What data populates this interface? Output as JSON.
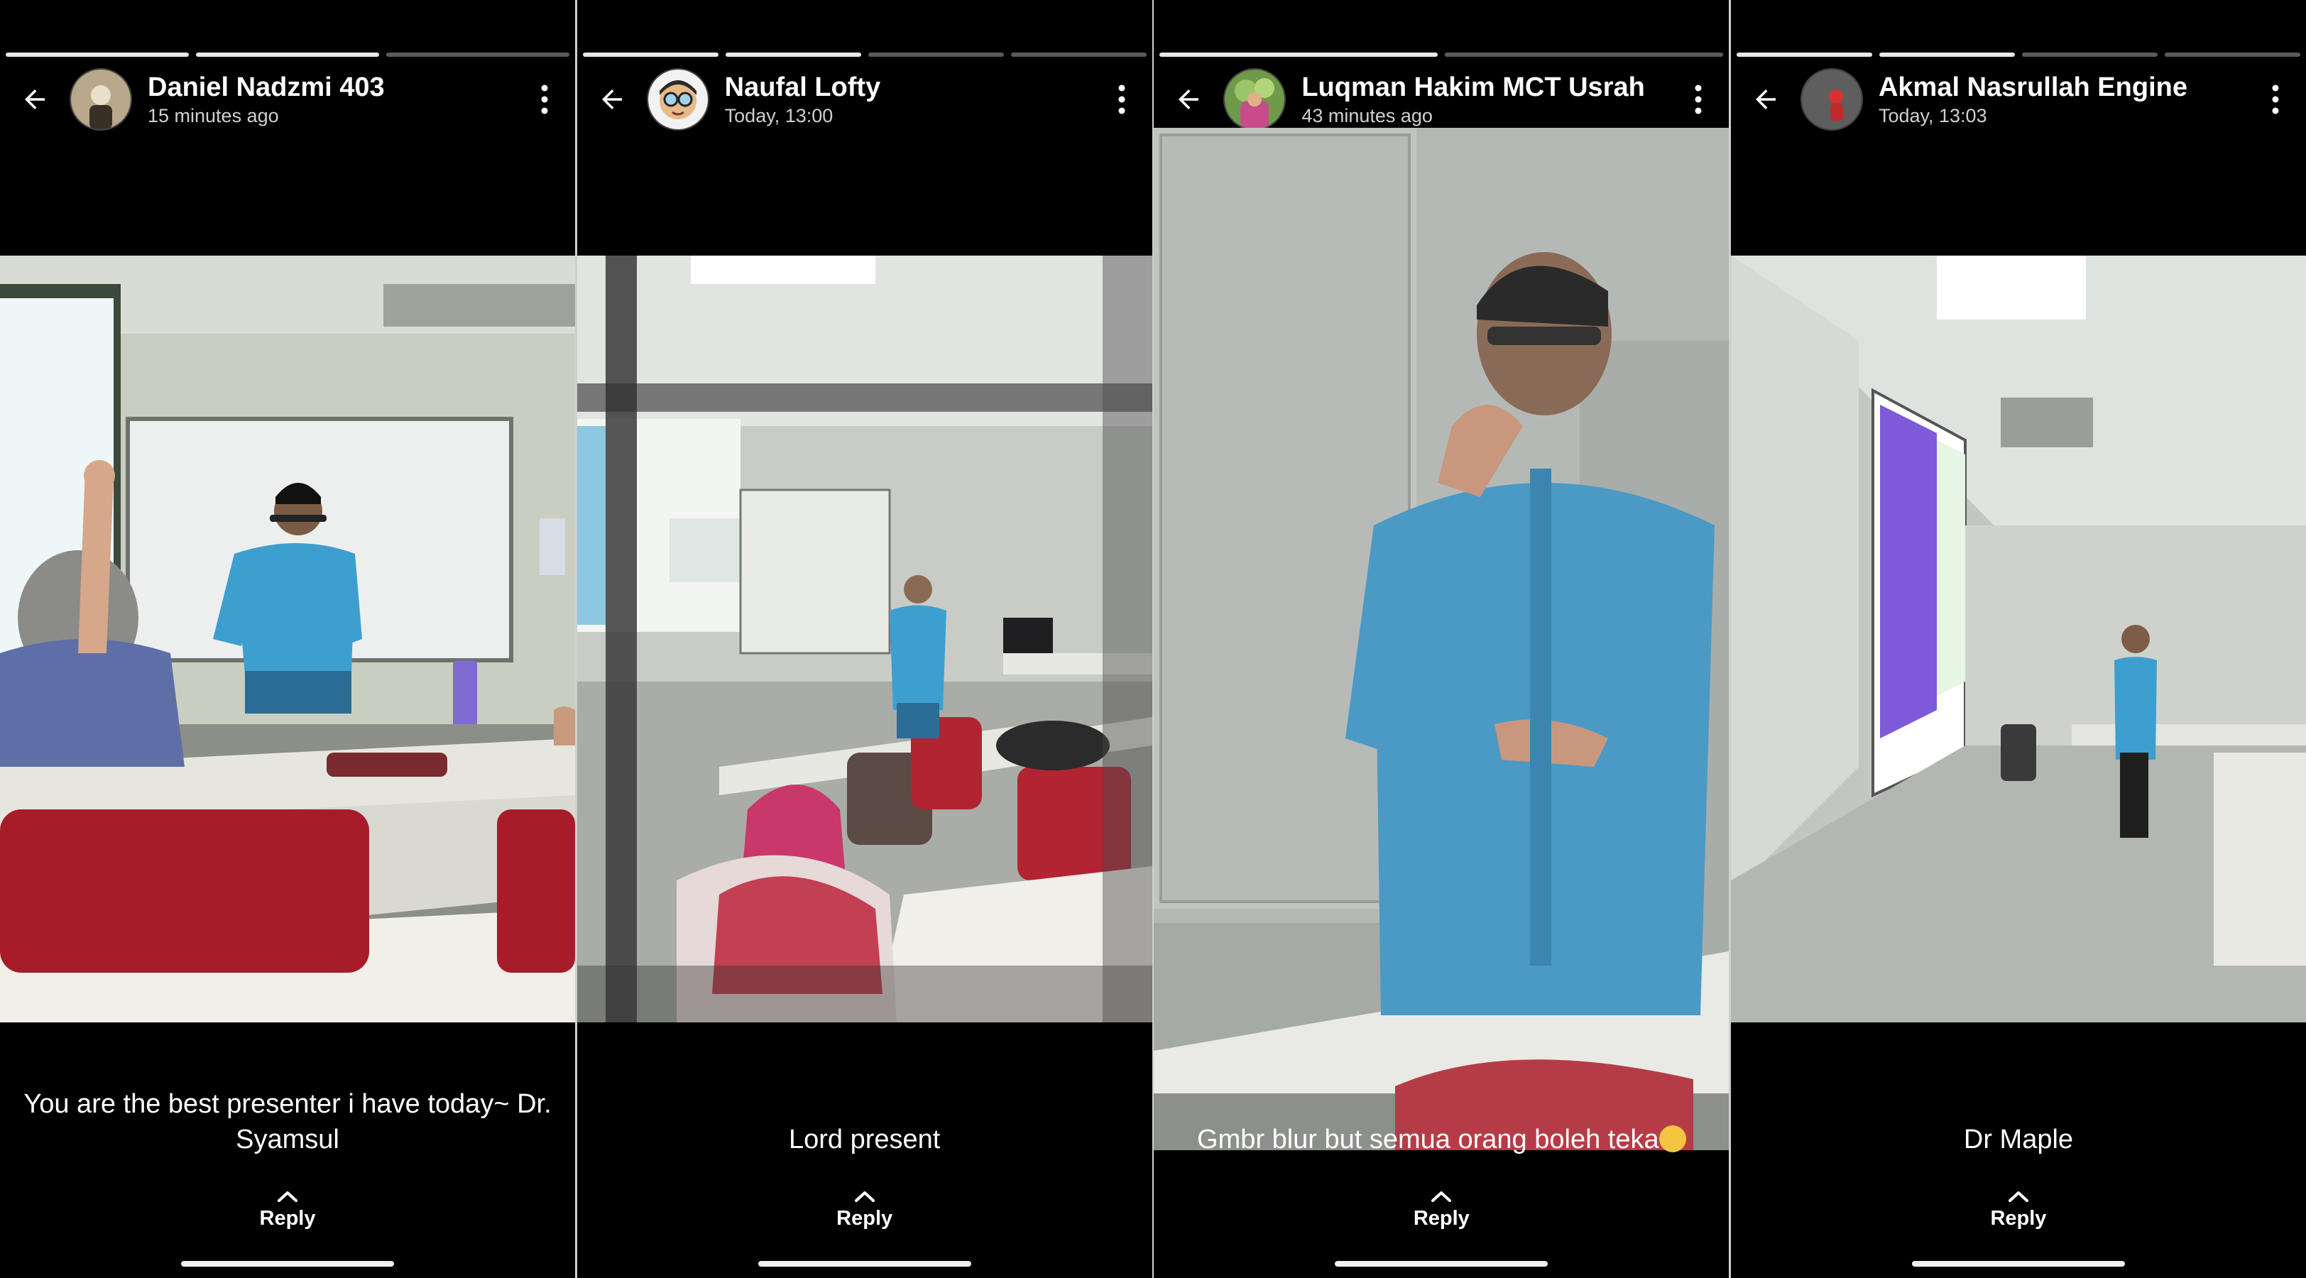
{
  "stories": [
    {
      "name": "Daniel Nadzmi 403",
      "time": "15 minutes ago",
      "caption": "You are the best presenter i have today~ Dr. Syamsul",
      "reply_label": "Reply",
      "progress_done": 0.66
    },
    {
      "name": "Naufal Lofty",
      "time": "Today, 13:00",
      "caption": "Lord present",
      "reply_label": "Reply",
      "progress_done": 0.5
    },
    {
      "name": "Luqman Hakim MCT Usrah",
      "time": "43 minutes ago",
      "caption": "Gmbr blur but semua orang boleh teka",
      "caption_emoji": "face-with-hand-over-mouth-emoji",
      "reply_label": "Reply",
      "progress_done": 0.5
    },
    {
      "name": "Akmal Nasrullah Engine",
      "time": "Today, 13:03",
      "caption": "Dr Maple",
      "reply_label": "Reply",
      "progress_done": 0.5
    }
  ],
  "icons": {
    "back": "arrow-left-icon",
    "menu": "more-vert-icon",
    "reply": "chevron-up-icon"
  },
  "colors": {
    "background": "#000000",
    "progress_done": "#e8e8e8",
    "progress_pending": "#5a5a5a",
    "shirt_blue": "#3d9fcf"
  }
}
